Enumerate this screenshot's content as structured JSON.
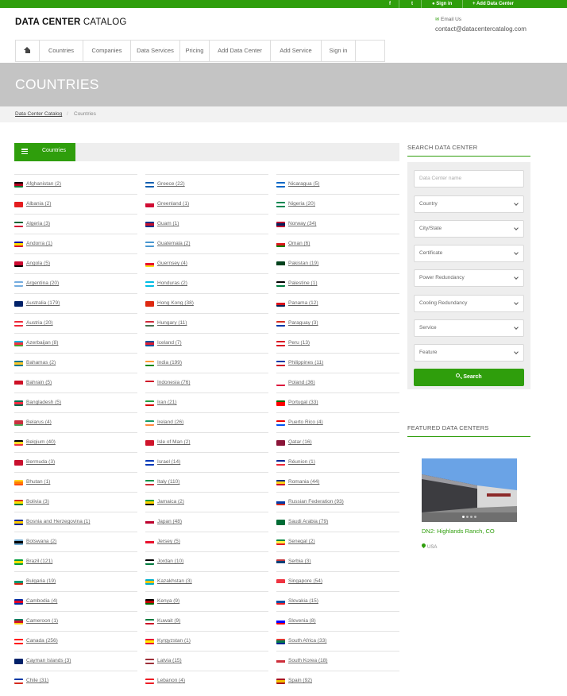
{
  "topbar": {
    "social": [
      "f",
      "t",
      "in"
    ],
    "signin_label": "Sign in",
    "add_dc_label": "Add Data Center"
  },
  "header": {
    "logo_bold": "DATA CENTER",
    "logo_light": "CATALOG",
    "email_label": "Email Us",
    "email": "contact@datacentercatalog.com"
  },
  "nav": [
    "Countries",
    "Companies",
    "Data Services",
    "Pricing",
    "Add Data Center",
    "Add Service",
    "Sign in"
  ],
  "page_title": "COUNTRIES",
  "breadcrumb": {
    "home": "Data Center Catalog",
    "separator": "/",
    "current": "Countries"
  },
  "tab": {
    "label": "Countries"
  },
  "columns": [
    [
      {
        "label": "Afghanistan (2)",
        "flag": [
          "#000000",
          "#b5001e",
          "#007a36"
        ]
      },
      {
        "label": "Albania (2)",
        "flag": [
          "#e41e20",
          "#e41e20",
          "#e41e20"
        ]
      },
      {
        "label": "Algeria (3)",
        "flag": [
          "#006233",
          "#ffffff",
          "#d21034"
        ]
      },
      {
        "label": "Andorra (1)",
        "flag": [
          "#10069f",
          "#fedd00",
          "#d50032"
        ]
      },
      {
        "label": "Angola (5)",
        "flag": [
          "#cc092f",
          "#cc092f",
          "#000000"
        ]
      },
      {
        "label": "Argentina (20)",
        "flag": [
          "#74acdf",
          "#ffffff",
          "#74acdf"
        ]
      },
      {
        "label": "Australia (179)",
        "flag": [
          "#012169",
          "#012169",
          "#012169"
        ]
      },
      {
        "label": "Austria (20)",
        "flag": [
          "#ed2939",
          "#ffffff",
          "#ed2939"
        ]
      },
      {
        "label": "Azerbaijan (8)",
        "flag": [
          "#00b5e2",
          "#ef3340",
          "#509e2f"
        ]
      },
      {
        "label": "Bahamas (2)",
        "flag": [
          "#00778b",
          "#ffc72c",
          "#00778b"
        ]
      },
      {
        "label": "Bahrain (5)",
        "flag": [
          "#ce1126",
          "#ce1126",
          "#ffffff"
        ]
      },
      {
        "label": "Bangladesh (5)",
        "flag": [
          "#006a4e",
          "#f42a41",
          "#006a4e"
        ]
      },
      {
        "label": "Belarus (4)",
        "flag": [
          "#c8313e",
          "#c8313e",
          "#4aa657"
        ]
      },
      {
        "label": "Belgium (40)",
        "flag": [
          "#000000",
          "#fdda24",
          "#ef3340"
        ]
      },
      {
        "label": "Bermuda (3)",
        "flag": [
          "#c8102e",
          "#c8102e",
          "#c8102e"
        ]
      },
      {
        "label": "Bhutan (1)",
        "flag": [
          "#ffd520",
          "#ff8000",
          "#ff4e12"
        ]
      },
      {
        "label": "Bolivia (3)",
        "flag": [
          "#d52b1e",
          "#f9e300",
          "#007934"
        ]
      },
      {
        "label": "Bosnia and Herzegovina (1)",
        "flag": [
          "#002395",
          "#fecb00",
          "#002395"
        ]
      },
      {
        "label": "Botswana (2)",
        "flag": [
          "#6da9d2",
          "#000000",
          "#6da9d2"
        ]
      },
      {
        "label": "Brazil (121)",
        "flag": [
          "#009c3b",
          "#ffdf00",
          "#009c3b"
        ]
      },
      {
        "label": "Bulgaria (19)",
        "flag": [
          "#ffffff",
          "#00966e",
          "#d62612"
        ]
      },
      {
        "label": "Cambodia (4)",
        "flag": [
          "#032ea1",
          "#e00025",
          "#032ea1"
        ]
      },
      {
        "label": "Cameroon (1)",
        "flag": [
          "#007a5e",
          "#ce1126",
          "#fcd116"
        ]
      },
      {
        "label": "Canada (256)",
        "flag": [
          "#ff0000",
          "#ffffff",
          "#ff0000"
        ]
      },
      {
        "label": "Cayman Islands (3)",
        "flag": [
          "#012169",
          "#012169",
          "#012169"
        ]
      },
      {
        "label": "Chile (31)",
        "flag": [
          "#0039a6",
          "#ffffff",
          "#d52b1e"
        ]
      }
    ],
    [
      {
        "label": "Greece (22)",
        "flag": [
          "#0d5eaf",
          "#ffffff",
          "#0d5eaf"
        ]
      },
      {
        "label": "Greenland (1)",
        "flag": [
          "#ffffff",
          "#d00c33",
          "#d00c33"
        ]
      },
      {
        "label": "Guam (1)",
        "flag": [
          "#003087",
          "#c8102e",
          "#003087"
        ]
      },
      {
        "label": "Guatemala (2)",
        "flag": [
          "#4997d0",
          "#ffffff",
          "#4997d0"
        ]
      },
      {
        "label": "Guernsey (4)",
        "flag": [
          "#ffffff",
          "#e8112d",
          "#f9dd16"
        ]
      },
      {
        "label": "Honduras (2)",
        "flag": [
          "#00bce4",
          "#ffffff",
          "#00bce4"
        ]
      },
      {
        "label": "Hong Kong (38)",
        "flag": [
          "#de2910",
          "#de2910",
          "#de2910"
        ]
      },
      {
        "label": "Hungary (11)",
        "flag": [
          "#ce2939",
          "#ffffff",
          "#477050"
        ]
      },
      {
        "label": "Iceland (7)",
        "flag": [
          "#02529c",
          "#dc1e35",
          "#02529c"
        ]
      },
      {
        "label": "India (199)",
        "flag": [
          "#ff9933",
          "#ffffff",
          "#138808"
        ]
      },
      {
        "label": "Indonesia (76)",
        "flag": [
          "#ce1126",
          "#ffffff",
          "#ffffff"
        ]
      },
      {
        "label": "Iran (21)",
        "flag": [
          "#239f40",
          "#ffffff",
          "#da0000"
        ]
      },
      {
        "label": "Ireland (26)",
        "flag": [
          "#169b62",
          "#ffffff",
          "#ff883e"
        ]
      },
      {
        "label": "Isle of Man (2)",
        "flag": [
          "#cf142b",
          "#cf142b",
          "#cf142b"
        ]
      },
      {
        "label": "Israel (14)",
        "flag": [
          "#0038b8",
          "#ffffff",
          "#0038b8"
        ]
      },
      {
        "label": "Italy (110)",
        "flag": [
          "#009246",
          "#ffffff",
          "#ce2b37"
        ]
      },
      {
        "label": "Jamaica (2)",
        "flag": [
          "#009b3a",
          "#fed100",
          "#000000"
        ]
      },
      {
        "label": "Japan (48)",
        "flag": [
          "#ffffff",
          "#bc002d",
          "#ffffff"
        ]
      },
      {
        "label": "Jersey (5)",
        "flag": [
          "#ffffff",
          "#e8112d",
          "#ffffff"
        ]
      },
      {
        "label": "Jordan (10)",
        "flag": [
          "#000000",
          "#ffffff",
          "#007a3d"
        ]
      },
      {
        "label": "Kazakhstan (3)",
        "flag": [
          "#00afca",
          "#fec50c",
          "#00afca"
        ]
      },
      {
        "label": "Kenya (9)",
        "flag": [
          "#000000",
          "#bb0000",
          "#006600"
        ]
      },
      {
        "label": "Kuwait (9)",
        "flag": [
          "#007a3d",
          "#ffffff",
          "#ce1126"
        ]
      },
      {
        "label": "Kyrgyzstan (1)",
        "flag": [
          "#e8112d",
          "#ffef00",
          "#e8112d"
        ]
      },
      {
        "label": "Latvia (15)",
        "flag": [
          "#9e3039",
          "#ffffff",
          "#9e3039"
        ]
      },
      {
        "label": "Lebanon (4)",
        "flag": [
          "#ed1c24",
          "#ffffff",
          "#ed1c24"
        ]
      }
    ],
    [
      {
        "label": "Nicaragua (5)",
        "flag": [
          "#0067c6",
          "#ffffff",
          "#0067c6"
        ]
      },
      {
        "label": "Nigeria (20)",
        "flag": [
          "#008751",
          "#ffffff",
          "#008751"
        ]
      },
      {
        "label": "Norway (34)",
        "flag": [
          "#ba0c2f",
          "#00205b",
          "#ba0c2f"
        ]
      },
      {
        "label": "Oman (6)",
        "flag": [
          "#ffffff",
          "#db161b",
          "#008000"
        ]
      },
      {
        "label": "Pakistan (19)",
        "flag": [
          "#01411c",
          "#01411c",
          "#ffffff"
        ]
      },
      {
        "label": "Palestine (1)",
        "flag": [
          "#000000",
          "#ffffff",
          "#007a3d"
        ]
      },
      {
        "label": "Panama (12)",
        "flag": [
          "#ffffff",
          "#da121a",
          "#072357"
        ]
      },
      {
        "label": "Paraguay (3)",
        "flag": [
          "#d52b1e",
          "#ffffff",
          "#0038a8"
        ]
      },
      {
        "label": "Peru (13)",
        "flag": [
          "#d91023",
          "#ffffff",
          "#d91023"
        ]
      },
      {
        "label": "Philippines (11)",
        "flag": [
          "#0038a8",
          "#ffffff",
          "#ce1126"
        ]
      },
      {
        "label": "Poland (36)",
        "flag": [
          "#ffffff",
          "#ffffff",
          "#dc143c"
        ]
      },
      {
        "label": "Portugal (33)",
        "flag": [
          "#006600",
          "#ff0000",
          "#ff0000"
        ]
      },
      {
        "label": "Puerto Rico (4)",
        "flag": [
          "#ed0000",
          "#ffffff",
          "#0050f0"
        ]
      },
      {
        "label": "Qatar (16)",
        "flag": [
          "#8a1538",
          "#8a1538",
          "#8a1538"
        ]
      },
      {
        "label": "Réunion (1)",
        "flag": [
          "#002395",
          "#ffffff",
          "#ed2939"
        ]
      },
      {
        "label": "Romania (44)",
        "flag": [
          "#002b7f",
          "#fcd116",
          "#ce1126"
        ]
      },
      {
        "label": "Russian Federation (93)",
        "flag": [
          "#ffffff",
          "#0039a6",
          "#d52b1e"
        ]
      },
      {
        "label": "Saudi Arabia (79)",
        "flag": [
          "#006c35",
          "#006c35",
          "#006c35"
        ]
      },
      {
        "label": "Senegal (2)",
        "flag": [
          "#00853f",
          "#fdef42",
          "#e31b23"
        ]
      },
      {
        "label": "Serbia (3)",
        "flag": [
          "#c6363c",
          "#0c4076",
          "#ffffff"
        ]
      },
      {
        "label": "Singapore (54)",
        "flag": [
          "#ef3340",
          "#ef3340",
          "#ffffff"
        ]
      },
      {
        "label": "Slovakia (15)",
        "flag": [
          "#ffffff",
          "#0b4ea2",
          "#ee1c25"
        ]
      },
      {
        "label": "Slovenia (8)",
        "flag": [
          "#ffffff",
          "#0000ff",
          "#ff0000"
        ]
      },
      {
        "label": "South Africa (33)",
        "flag": [
          "#de3831",
          "#007a4d",
          "#002395"
        ]
      },
      {
        "label": "South Korea (18)",
        "flag": [
          "#ffffff",
          "#cd2e3a",
          "#ffffff"
        ]
      },
      {
        "label": "Spain (92)",
        "flag": [
          "#aa151b",
          "#f1bf00",
          "#aa151b"
        ]
      }
    ]
  ],
  "search": {
    "title": "SEARCH DATA CENTER",
    "name_placeholder": "Data Center name",
    "selects": [
      "Country",
      "City/State",
      "Certificate",
      "Power Redundancy",
      "Cooling Redundancy",
      "Service",
      "Feature"
    ],
    "button": "Search"
  },
  "featured": {
    "title": "FEATURED DATA CENTERS",
    "name": "DN2: Highlands Ranch, CO",
    "location": "USA"
  },
  "colors": {
    "accent": "#2f9e0c",
    "banner": "#c4c4c4"
  }
}
